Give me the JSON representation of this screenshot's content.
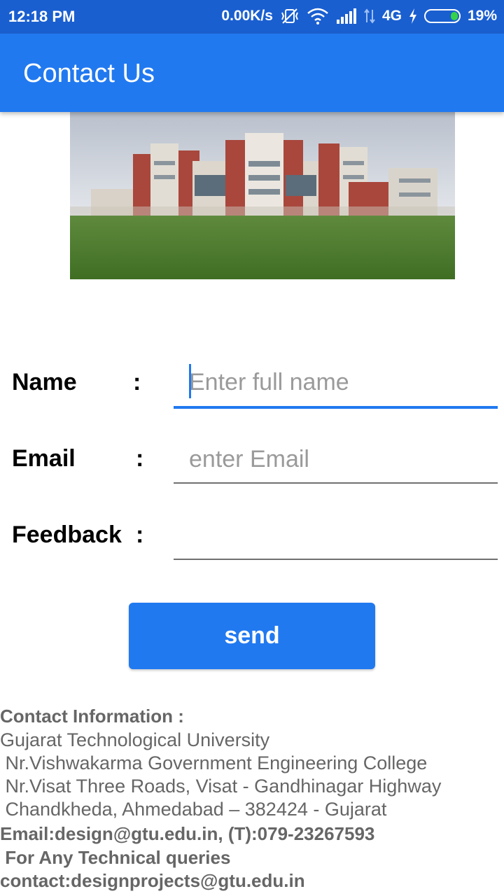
{
  "status_bar": {
    "time": "12:18 PM",
    "net_speed": "0.00K/s",
    "network_type": "4G",
    "battery": "19%",
    "battery_level": 0.19,
    "battery_fill_color": "#35d24a",
    "icons": [
      "vibrate-off-icon",
      "wifi-icon",
      "signal-icon",
      "data-arrows-icon",
      "charging-icon",
      "battery-icon"
    ]
  },
  "app_bar": {
    "title": "Contact Us",
    "color": "#2179f0"
  },
  "hero_image": {
    "subject": "university-building-photo"
  },
  "form": {
    "name": {
      "label": "Name",
      "colon": ":",
      "placeholder": "Enter full name",
      "value": ""
    },
    "email": {
      "label": "Email",
      "colon": ":",
      "placeholder": "enter Email",
      "value": ""
    },
    "feedback": {
      "label": "Feedback",
      "colon": ":",
      "placeholder": "",
      "value": ""
    },
    "send_label": "send"
  },
  "contact": {
    "heading": "Contact Information :",
    "org": "Gujarat Technological University",
    "address_1": " Nr.Vishwakarma Government Engineering College",
    "address_2": " Nr.Visat Three Roads, Visat - Gandhinagar Highway",
    "address_3": " Chandkheda, Ahmedabad – 382424 - Gujarat",
    "email_phone": "Email:design@gtu.edu.in, (T):079-23267593",
    "queries": " For Any Technical queries",
    "queries_contact": "contact:designprojects@gtu.edu.in"
  }
}
